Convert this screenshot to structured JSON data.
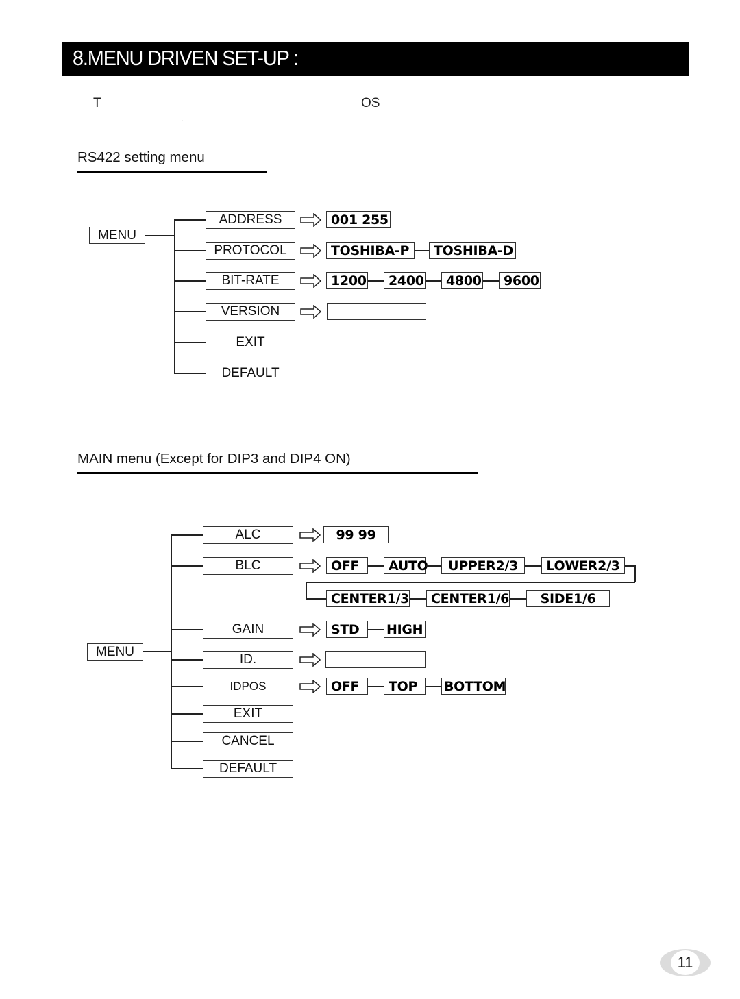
{
  "header": {
    "title": "8.MENU DRIVEN SET-UP :"
  },
  "intro": {
    "fragment_1": "T",
    "fragment_2": "OS",
    "fragment_3": "."
  },
  "rs422": {
    "title": "RS422 setting menu",
    "root_label": "MENU",
    "items": [
      {
        "label": "ADDRESS",
        "values": [
          "001  255"
        ]
      },
      {
        "label": "PROTOCOL",
        "values": [
          "TOSHIBA-P",
          "TOSHIBA-D"
        ]
      },
      {
        "label": "BIT-RATE",
        "values": [
          "1200",
          "2400",
          "4800",
          "9600"
        ]
      },
      {
        "label": "VERSION",
        "values": [
          ""
        ]
      },
      {
        "label": "EXIT"
      },
      {
        "label": "DEFAULT"
      }
    ]
  },
  "main": {
    "title": "MAIN menu (Except for DIP3 and DIP4 ON)",
    "root_label": "MENU",
    "items": [
      {
        "label": "ALC",
        "values": [
          "99  99"
        ]
      },
      {
        "label": "BLC",
        "values": [
          "OFF",
          "AUTO",
          "UPPER2/3",
          "LOWER2/3",
          "CENTER1/3",
          "CENTER1/6",
          "SIDE1/6"
        ]
      },
      {
        "label": "GAIN",
        "values": [
          "STD",
          "HIGH"
        ]
      },
      {
        "label": "ID.",
        "values": [
          ""
        ]
      },
      {
        "label": "IDPOS",
        "values": [
          "OFF",
          "TOP",
          "BOTTOM"
        ]
      },
      {
        "label": "EXIT"
      },
      {
        "label": "CANCEL"
      },
      {
        "label": "DEFAULT"
      }
    ]
  },
  "footer": {
    "page_number": "11"
  }
}
